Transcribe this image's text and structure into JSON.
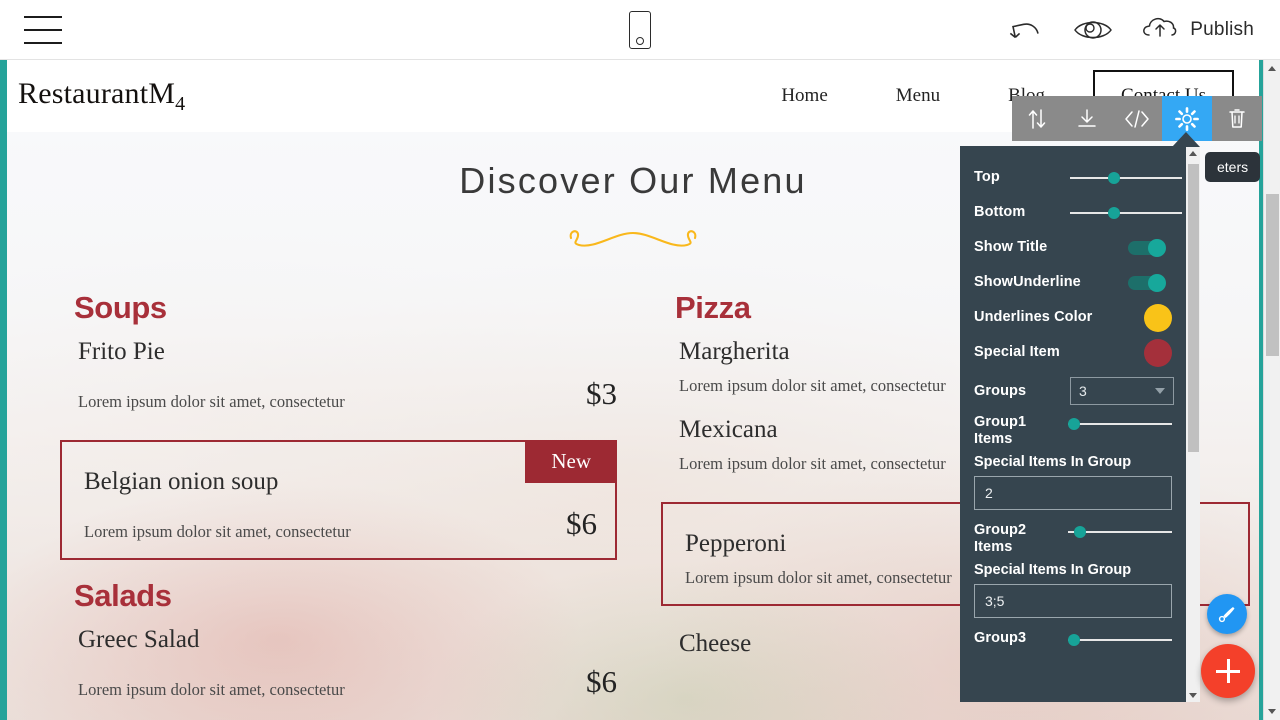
{
  "builder_bar": {
    "menu_icon": "hamburger-icon",
    "device_icon": "mobile-preview-icon",
    "undo_icon": "undo-arrow-icon",
    "preview_icon": "eye-preview-icon",
    "publish_icon": "cloud-upload-icon",
    "publish_label": "Publish"
  },
  "site": {
    "brand": "RestaurantM",
    "brand_sub": "4",
    "nav": [
      {
        "label": "Home"
      },
      {
        "label": "Menu"
      },
      {
        "label": "Blog"
      }
    ],
    "contact_button": "Contact Us",
    "menu_title": "Discover Our Menu",
    "columns": [
      {
        "groups": [
          {
            "heading": "Soups",
            "items": [
              {
                "name": "Frito Pie",
                "desc": "Lorem ipsum dolor sit amet, consectetur",
                "price": "$3",
                "special": false,
                "badge": ""
              },
              {
                "name": "Belgian onion soup",
                "desc": "Lorem ipsum dolor sit amet, consectetur",
                "price": "$6",
                "special": true,
                "badge": "New"
              }
            ]
          },
          {
            "heading": "Salads",
            "items": [
              {
                "name": "Greec Salad",
                "desc": "Lorem ipsum dolor sit amet, consectetur",
                "price": "$6",
                "special": false,
                "badge": ""
              }
            ]
          }
        ]
      },
      {
        "groups": [
          {
            "heading": "Pizza",
            "items": [
              {
                "name": "Margherita",
                "desc": "Lorem ipsum dolor sit amet, consectetur",
                "price": "",
                "special": false,
                "badge": ""
              },
              {
                "name": "Mexicana",
                "desc": "Lorem ipsum dolor sit amet, consectetur",
                "price": "",
                "special": false,
                "badge": ""
              },
              {
                "name": "Pepperoni",
                "desc": "Lorem ipsum dolor sit amet, consectetur",
                "price": "",
                "special": true,
                "badge": ""
              },
              {
                "name": "Cheese",
                "desc": "",
                "price": "",
                "special": false,
                "badge": ""
              }
            ]
          }
        ]
      }
    ]
  },
  "block_toolbar": {
    "buttons": [
      {
        "name": "move-block",
        "icon": "move-updown-icon",
        "active": false
      },
      {
        "name": "save-block",
        "icon": "download-icon",
        "active": false
      },
      {
        "name": "edit-code",
        "icon": "code-brackets-icon",
        "active": false
      },
      {
        "name": "settings",
        "icon": "gear-icon",
        "active": true
      },
      {
        "name": "delete-block",
        "icon": "trash-icon",
        "active": false
      }
    ]
  },
  "tooltip": {
    "text": "eters"
  },
  "settings_panel": {
    "rows": [
      {
        "type": "slider",
        "label": "Top",
        "value": 34
      },
      {
        "type": "slider",
        "label": "Bottom",
        "value": 34
      },
      {
        "type": "toggle",
        "label": "Show Title",
        "value": "on"
      },
      {
        "type": "toggle",
        "label": "ShowUnderline",
        "value": "on"
      },
      {
        "type": "color",
        "label": "Underlines Color",
        "value": "#f9c318"
      },
      {
        "type": "color",
        "label": "Special Item",
        "value": "#a4303b"
      },
      {
        "type": "select",
        "label": "Groups",
        "value": "3"
      },
      {
        "type": "slider_stacked",
        "label": "Group1 Items",
        "value": 0
      },
      {
        "type": "input",
        "label": "Special Items In Group",
        "value": "2"
      },
      {
        "type": "slider_stacked",
        "label": "Group2 Items",
        "value": 6
      },
      {
        "type": "input",
        "label": "Special Items In Group",
        "value": "3;5"
      },
      {
        "type": "slider_stacked",
        "label": "Group3",
        "value": 0
      }
    ]
  },
  "fab": {
    "brush_icon": "paintbrush-icon",
    "add_icon": "plus-icon"
  },
  "colors": {
    "panel_bg": "#36454f",
    "accent_teal": "#17a398",
    "active_blue": "#34a8f4",
    "special_red": "#9d2933",
    "underline_yellow": "#f9c318"
  }
}
